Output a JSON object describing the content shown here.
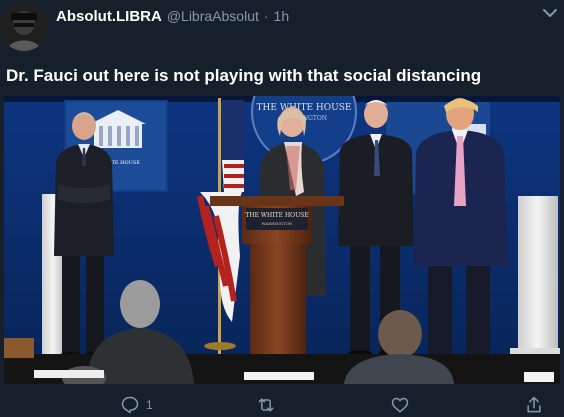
{
  "tweet": {
    "display_name": "Absolut.LIBRA",
    "handle": "@LibraAbsolut",
    "separator": "·",
    "time": "1h",
    "text": "Dr. Fauci out here is not playing with that social distancing",
    "media": {
      "backdrop_text": "THE WHITE HOUSE",
      "backdrop_subtext": "WASHINGTON",
      "screen_text": "WHITE HOUSE",
      "podium_title": "THE WHITE HOUSE",
      "podium_subtitle": "WASHINGTON"
    },
    "actions": {
      "reply_count": "1",
      "retweet_count": "",
      "like_count": ""
    }
  },
  "colors": {
    "background": "#15202b",
    "text": "#ffffff",
    "secondary": "#8899a6",
    "backdrop_blue": "#0b2c68"
  },
  "icons": {
    "caret": "chevron-down-icon",
    "reply": "reply-icon",
    "retweet": "retweet-icon",
    "like": "heart-icon",
    "share": "share-icon"
  }
}
